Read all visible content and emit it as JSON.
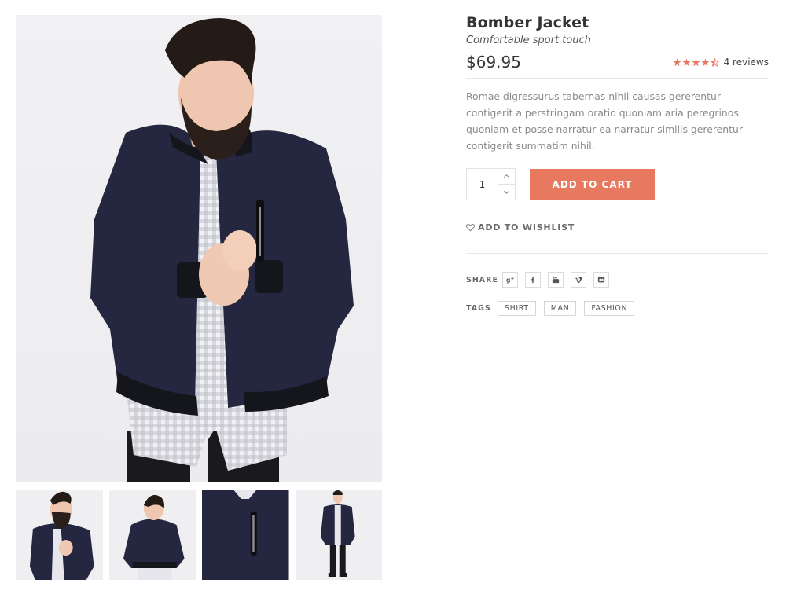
{
  "product": {
    "title": "Bomber Jacket",
    "subtitle": "Comfortable sport touch",
    "price": "$69.95",
    "rating": {
      "stars": 4.5,
      "max": 5,
      "reviews_label": "4 reviews"
    },
    "description": "Romae digressurus tabernas nihil causas gererentur contigerit a perstringam oratio quoniam aria peregrinos quoniam et posse narratur ea narratur similis gererentur contigerit summatim nihil."
  },
  "cart": {
    "quantity": "1",
    "add_to_cart_label": "ADD TO CART",
    "accent_color": "#e6795f"
  },
  "wishlist": {
    "label": "ADD TO WISHLIST",
    "icon": "heart-icon"
  },
  "share": {
    "label": "SHARE",
    "networks": [
      {
        "name": "google-plus",
        "icon": "google-plus-icon",
        "glyph": "g+"
      },
      {
        "name": "facebook",
        "icon": "facebook-icon",
        "glyph": "f"
      },
      {
        "name": "youtube",
        "icon": "youtube-icon",
        "glyph": "yt"
      },
      {
        "name": "vimeo",
        "icon": "vimeo-icon",
        "glyph": "v"
      },
      {
        "name": "flickr",
        "icon": "flickr-icon",
        "glyph": "••"
      }
    ]
  },
  "tags": {
    "label": "TAGS",
    "items": [
      "SHIRT",
      "MAN",
      "FASHION"
    ]
  },
  "gallery": {
    "main_image": "product-photo-man-in-navy-bomber-jacket",
    "thumbnails": [
      "thumbnail-front-view",
      "thumbnail-back-view",
      "thumbnail-detail-view",
      "thumbnail-full-body-view"
    ]
  },
  "colors": {
    "jacket": "#25263f",
    "star": "#e6795f",
    "text_dark": "#333333",
    "text_muted": "#8a8a8a"
  }
}
